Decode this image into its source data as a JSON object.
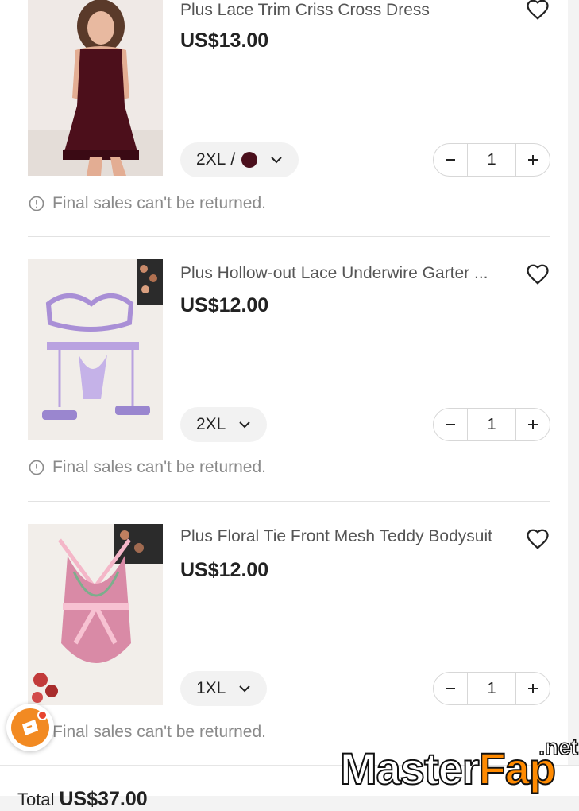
{
  "cart": {
    "items": [
      {
        "title": "Plus Lace Trim Criss Cross Dress",
        "price": "US$13.00",
        "size": "2XL",
        "separator": "/",
        "swatch_color": "#4a0f1c",
        "quantity": "1",
        "notice": "Final sales can't be returned."
      },
      {
        "title": "Plus Hollow-out Lace Underwire Garter ...",
        "price": "US$12.00",
        "size": "2XL",
        "quantity": "1",
        "notice": "Final sales can't be returned."
      },
      {
        "title": "Plus Floral Tie Front Mesh Teddy Bodysuit",
        "price": "US$12.00",
        "size": "1XL",
        "quantity": "1",
        "notice": "Final sales can't be returned."
      }
    ]
  },
  "footer": {
    "total_label": "Total",
    "total_amount": "US$37.00"
  },
  "watermark": {
    "part1": "Master",
    "part2": "Fap",
    "suffix": ".net"
  },
  "colors": {
    "accent_orange": "#f28a22",
    "price_text": "#222222",
    "notice_text": "#8a8a8a"
  },
  "icons": [
    "heart-icon",
    "chevron-down-icon",
    "minus-icon",
    "plus-icon",
    "info-icon",
    "coupon-icon"
  ]
}
